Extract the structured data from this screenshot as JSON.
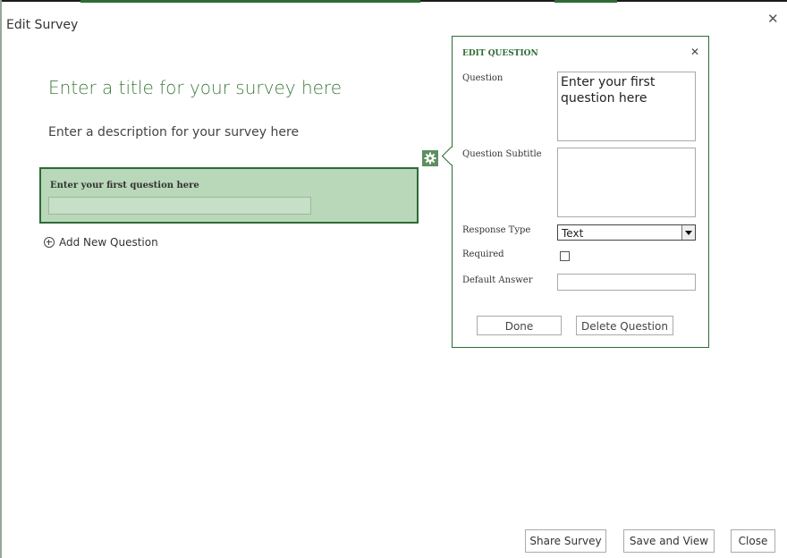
{
  "colors": {
    "accent": "#2e6b34",
    "title_green": "#3f7c3f",
    "card_fill": "#b9d7b9"
  },
  "dialog": {
    "title": "Edit Survey",
    "close_icon": "close-icon"
  },
  "survey": {
    "title": "Enter a title for your survey here",
    "description": "Enter a description for your survey here",
    "question_card": {
      "label": "Enter your first question here",
      "input_value": ""
    },
    "gear_icon": "gear-icon",
    "add_question": "Add New Question",
    "add_icon": "plus-circle-icon"
  },
  "edit_panel": {
    "title": "EDIT QUESTION",
    "close_icon": "close-icon",
    "question_label": "Question",
    "question_value": "Enter your first question here",
    "subtitle_label": "Question Subtitle",
    "subtitle_value": "",
    "response_type_label": "Response Type",
    "response_type_value": "Text",
    "required_label": "Required",
    "required_checked": false,
    "default_answer_label": "Default Answer",
    "default_answer_value": "",
    "done_button": "Done",
    "delete_button": "Delete Question"
  },
  "footer": {
    "share_button": "Share Survey",
    "save_view_button": "Save and View",
    "close_button": "Close"
  }
}
